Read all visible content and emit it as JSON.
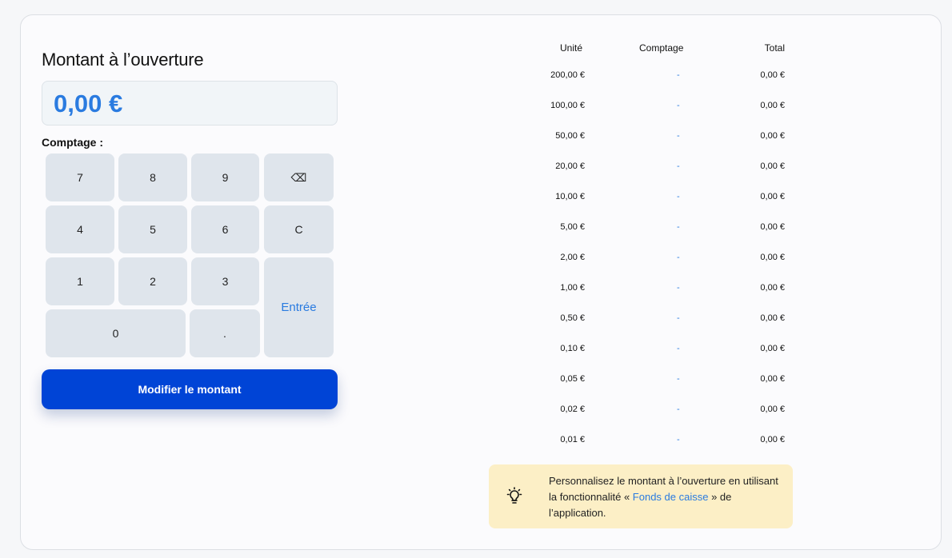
{
  "panel": {
    "title": "Montant à l’ouverture",
    "amount": "0,00 €",
    "comptage_label": "Comptage :",
    "modify_button": "Modifier le montant"
  },
  "keypad": {
    "k7": "7",
    "k8": "8",
    "k9": "9",
    "backspace": "⌫",
    "k4": "4",
    "k5": "5",
    "k6": "6",
    "clear": "C",
    "k1": "1",
    "k2": "2",
    "k3": "3",
    "enter": "Entrée",
    "k0": "0",
    "dot": "."
  },
  "table": {
    "headers": {
      "unit": "Unité",
      "count": "Comptage",
      "total": "Total"
    },
    "rows": [
      {
        "unit": "200,00 €",
        "count": "-",
        "total": "0,00 €"
      },
      {
        "unit": "100,00 €",
        "count": "-",
        "total": "0,00 €"
      },
      {
        "unit": "50,00 €",
        "count": "-",
        "total": "0,00 €"
      },
      {
        "unit": "20,00 €",
        "count": "-",
        "total": "0,00 €"
      },
      {
        "unit": "10,00 €",
        "count": "-",
        "total": "0,00 €"
      },
      {
        "unit": "5,00 €",
        "count": "-",
        "total": "0,00 €"
      },
      {
        "unit": "2,00 €",
        "count": "-",
        "total": "0,00 €"
      },
      {
        "unit": "1,00 €",
        "count": "-",
        "total": "0,00 €"
      },
      {
        "unit": "0,50 €",
        "count": "-",
        "total": "0,00 €"
      },
      {
        "unit": "0,10 €",
        "count": "-",
        "total": "0,00 €"
      },
      {
        "unit": "0,05 €",
        "count": "-",
        "total": "0,00 €"
      },
      {
        "unit": "0,02 €",
        "count": "-",
        "total": "0,00 €"
      },
      {
        "unit": "0,01 €",
        "count": "-",
        "total": "0,00 €"
      }
    ]
  },
  "tip": {
    "icon": "lightbulb-icon",
    "text_before": "Personnalisez le montant à l’ouverture en utilisant la fonctionnalité « ",
    "link": "Fonds de caisse",
    "text_after": " » de l’application."
  },
  "colors": {
    "accent": "#2a7be0",
    "primary_button": "#0044d6",
    "key_bg": "#dfe5ec",
    "tip_bg": "#fcefc6"
  }
}
